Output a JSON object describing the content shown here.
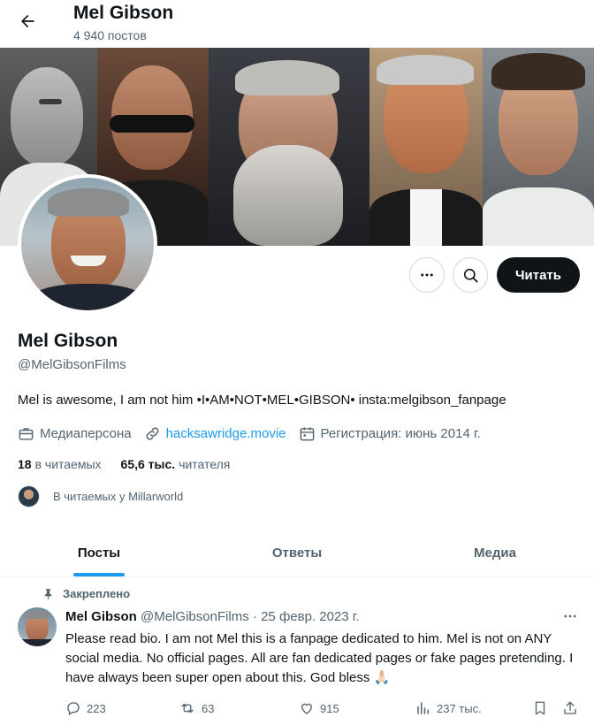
{
  "header": {
    "title": "Mel Gibson",
    "post_count": "4 940 постов"
  },
  "profile": {
    "name": "Mel Gibson",
    "handle": "@MelGibsonFilms",
    "bio": "Mel is awesome, I am not him •I•AM•NOT•MEL•GIBSON• insta:melgibson_fanpage",
    "category": "Медиаперсона",
    "website": "hacksawridge.movie",
    "joined": "Регистрация: июнь 2014 г.",
    "following_count": "18",
    "following_label": "в читаемых",
    "followers_count": "65,6 тыс.",
    "followers_label": "читателя",
    "followed_by": "В читаемых у Millarworld",
    "follow_button": "Читать"
  },
  "tabs": [
    {
      "label": "Посты",
      "active": true
    },
    {
      "label": "Ответы",
      "active": false
    },
    {
      "label": "Медиа",
      "active": false
    }
  ],
  "tweet": {
    "pinned_label": "Закреплено",
    "author": "Mel Gibson",
    "handle_date": "@MelGibsonFilms · 25 февр. 2023 г.",
    "text": "Please read bio. I am not Mel this is a fanpage dedicated to him. Mel is not on ANY social media. No official pages. All are fan dedicated pages or fake pages pretending. I have always been super open about this. God bless 🙏🏻",
    "replies": "223",
    "reposts": "63",
    "likes": "915",
    "views": "237 тыс."
  },
  "icons": {
    "back": "arrow-left-icon",
    "more": "more-dots-icon",
    "search": "search-icon",
    "category": "briefcase-icon",
    "link": "link-icon",
    "calendar": "calendar-icon",
    "pin": "pin-icon",
    "reply": "reply-icon",
    "repost": "repost-icon",
    "like": "heart-icon",
    "views": "views-icon",
    "bookmark": "bookmark-icon",
    "share": "share-icon"
  },
  "colors": {
    "accent": "#1d9bf0",
    "text": "#0f1419",
    "muted": "#536471",
    "button_dark": "#0f1419"
  }
}
